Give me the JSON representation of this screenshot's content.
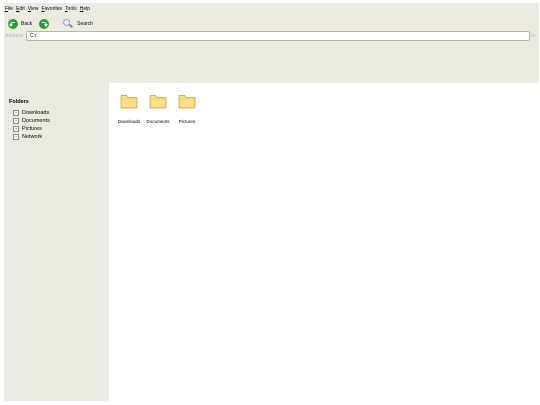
{
  "menu": [
    {
      "accel": "F",
      "rest": "ile"
    },
    {
      "accel": "E",
      "rest": "dit"
    },
    {
      "accel": "V",
      "rest": "iew"
    },
    {
      "accel": "F",
      "rest": "avorites"
    },
    {
      "accel": "T",
      "rest": "ools"
    },
    {
      "accel": "H",
      "rest": "elp"
    }
  ],
  "toolbar": {
    "back_label": "Back",
    "search_label": "Search",
    "icons": [
      "back-arrow-icon",
      "forward-arrow-icon",
      "magnifier-icon"
    ]
  },
  "address": {
    "label": "Address",
    "value": "C:/",
    "go_label": "Go"
  },
  "folders": {
    "title": "Folders",
    "items": [
      {
        "expander": "+",
        "label": "Downloads"
      },
      {
        "expander": "+",
        "label": "Documents"
      },
      {
        "expander": "+",
        "label": "Pictures"
      },
      {
        "expander": "+",
        "label": "Network"
      }
    ]
  },
  "files": [
    {
      "name": "Downloads",
      "icon": "folder-icon"
    },
    {
      "name": "Documents",
      "icon": "folder-icon"
    },
    {
      "name": "Pictures",
      "icon": "folder-icon"
    }
  ],
  "colors": {
    "chrome": "#ecebe2",
    "content": "#ffffff",
    "folder_fill": "#f7e08a",
    "folder_stroke": "#b89a3c",
    "nav_green": "#2f9a3a"
  }
}
